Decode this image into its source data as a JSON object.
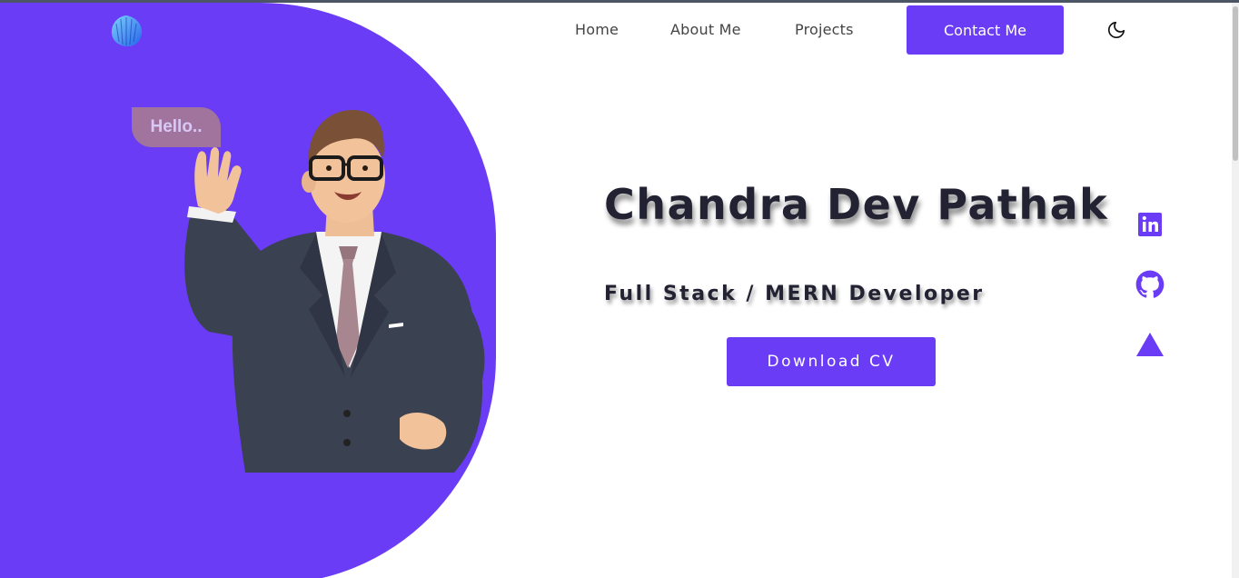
{
  "colors": {
    "accent": "#6a3cf6",
    "text_dark": "#222233",
    "nav_text": "#444444",
    "bubble": "#a0749c"
  },
  "header": {
    "logo_icon": "shell-logo-icon",
    "nav": {
      "home": "Home",
      "about": "About Me",
      "projects": "Projects",
      "contact": "Contact Me"
    },
    "theme_toggle_icon": "moon-icon"
  },
  "hero": {
    "bubble_text": "Hello..",
    "avatar_icon": "waving-man-avatar",
    "name": "Chandra Dev Pathak",
    "role": "Full Stack / MERN Developer",
    "cv_button": "Download CV"
  },
  "social": [
    {
      "icon": "linkedin-icon"
    },
    {
      "icon": "github-icon"
    },
    {
      "icon": "triangle-icon"
    }
  ]
}
